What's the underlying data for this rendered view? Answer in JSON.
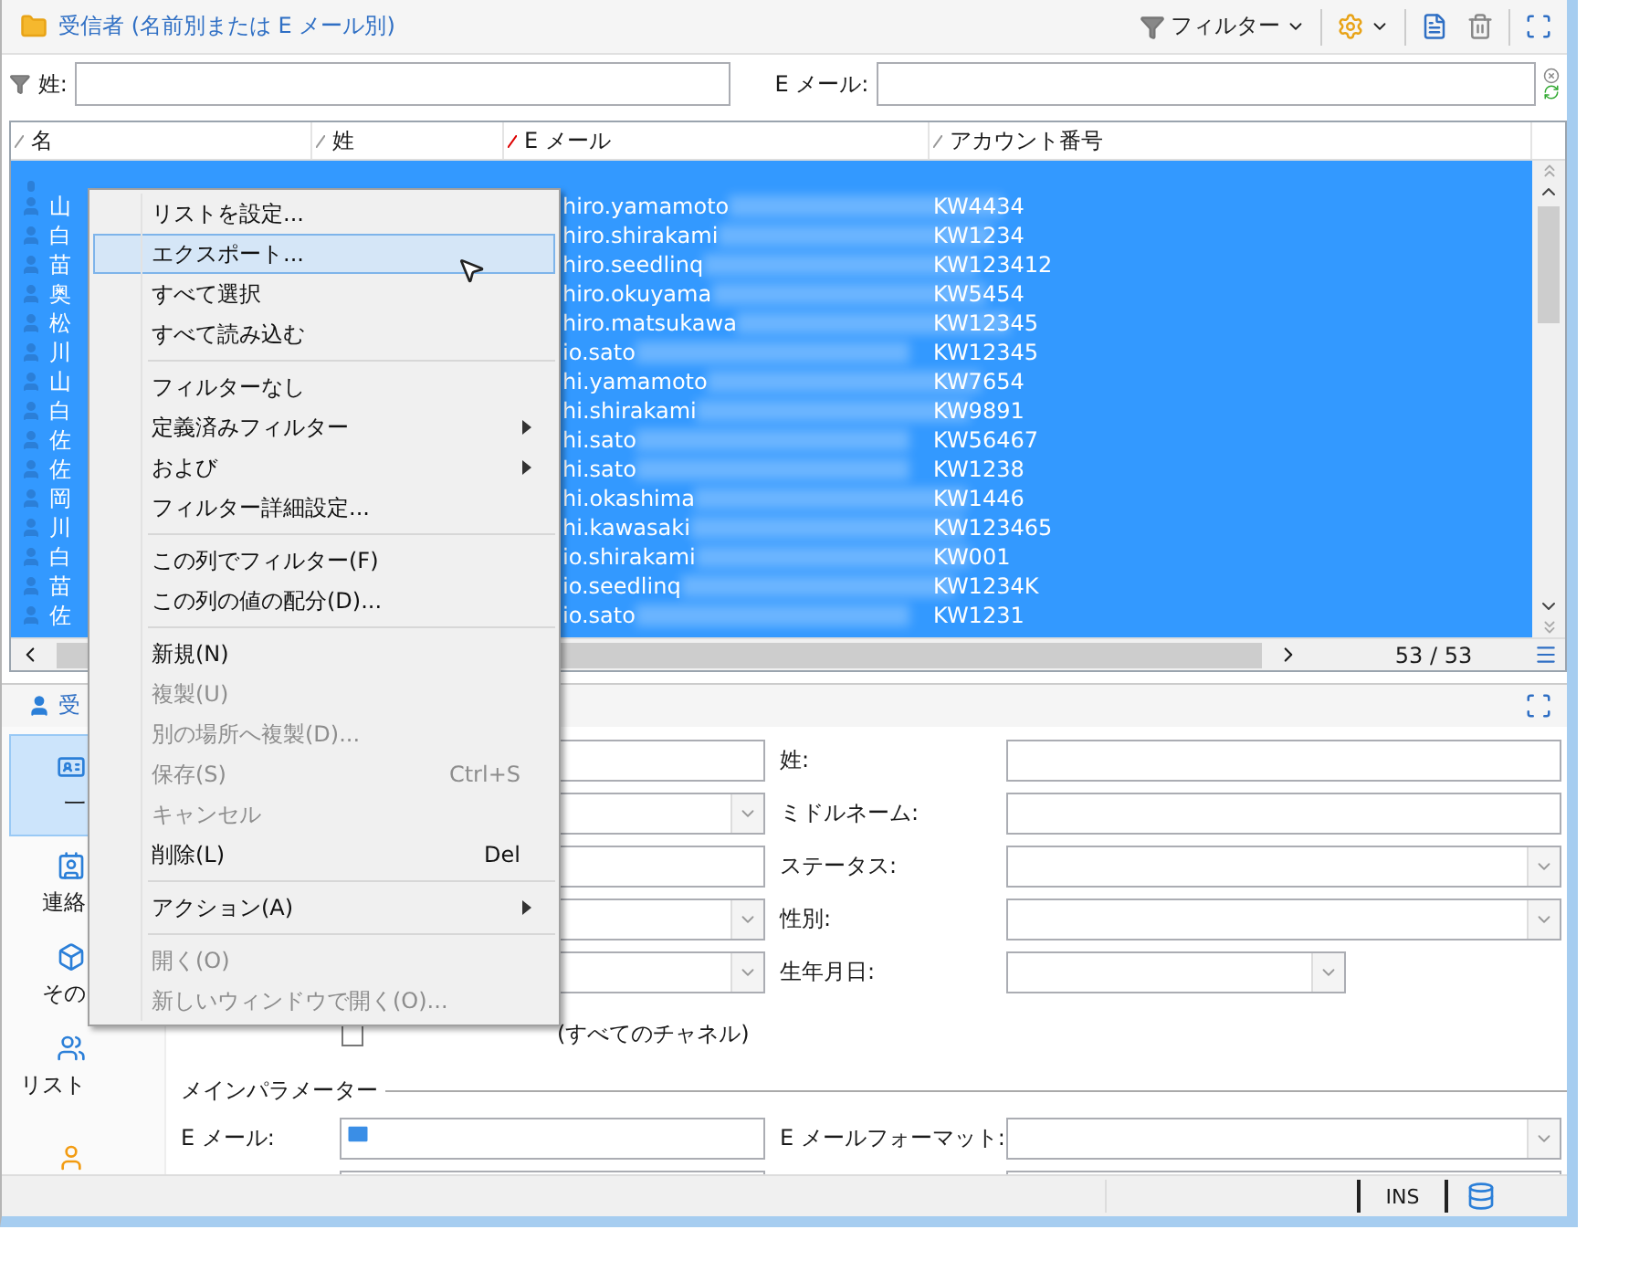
{
  "header": {
    "title": "受信者 (名前別または E メール別)",
    "filter_button": "フィルター"
  },
  "filter_bar": {
    "last_name_label": "姓:",
    "email_label": "E メール:"
  },
  "table": {
    "columns": [
      "名",
      "姓",
      "E メール",
      "アカウント番号"
    ],
    "rows": [
      {
        "first_name": "山",
        "email": "hiro.yamamoto",
        "account": "KW4434",
        "selected": true
      },
      {
        "first_name": "白",
        "email": "hiro.shirakami",
        "account": "KW1234",
        "selected": true
      },
      {
        "first_name": "苗",
        "email": "hiro.seedlinq",
        "account": "KW123412",
        "selected": true
      },
      {
        "first_name": "奥",
        "email": "hiro.okuyama",
        "account": "KW5454",
        "selected": true
      },
      {
        "first_name": "松",
        "email": "hiro.matsukawa",
        "account": "KW12345",
        "selected": true
      },
      {
        "first_name": "川",
        "email": "io.sato",
        "account": "KW12345",
        "selected": true
      },
      {
        "first_name": "山",
        "email": "hi.yamamoto",
        "account": "KW7654",
        "selected": true
      },
      {
        "first_name": "白",
        "email": "hi.shirakami",
        "account": "KW9891",
        "selected": true
      },
      {
        "first_name": "佐",
        "email": "hi.sato",
        "account": "KW56467",
        "selected": true
      },
      {
        "first_name": "佐",
        "email": "hi.sato",
        "account": "KW1238",
        "selected": true
      },
      {
        "first_name": "岡",
        "email": "hi.okashima",
        "account": "KW1446",
        "selected": true
      },
      {
        "first_name": "川",
        "email": "hi.kawasaki",
        "account": "KW123465",
        "selected": true
      },
      {
        "first_name": "白",
        "email": "io.shirakami",
        "account": "KW001",
        "selected": true
      },
      {
        "first_name": "苗",
        "email": "io.seedlinq",
        "account": "KW1234K",
        "selected": true
      },
      {
        "first_name": "佐",
        "email": "io.sato",
        "account": "KW1231",
        "selected": true
      }
    ],
    "count": "53 / 53"
  },
  "context_menu": {
    "items": [
      {
        "kind": "item",
        "label": "リストを設定...",
        "selected": false,
        "disabled": false
      },
      {
        "kind": "item",
        "label": "エクスポート...",
        "selected": true,
        "disabled": false
      },
      {
        "kind": "item",
        "label": "すべて選択",
        "selected": false,
        "disabled": false
      },
      {
        "kind": "item",
        "label": "すべて読み込む",
        "selected": false,
        "disabled": false
      },
      {
        "kind": "separator"
      },
      {
        "kind": "item",
        "label": "フィルターなし",
        "selected": false,
        "disabled": false
      },
      {
        "kind": "submenu",
        "label": "定義済みフィルター",
        "selected": false,
        "disabled": false
      },
      {
        "kind": "submenu",
        "label": "および",
        "selected": false,
        "disabled": false
      },
      {
        "kind": "item",
        "label": "フィルター詳細設定...",
        "selected": false,
        "disabled": false
      },
      {
        "kind": "separator"
      },
      {
        "kind": "item",
        "label": "この列でフィルター(F)",
        "selected": false,
        "disabled": false
      },
      {
        "kind": "item",
        "label": "この列の値の配分(D)...",
        "selected": false,
        "disabled": false
      },
      {
        "kind": "separator"
      },
      {
        "kind": "item",
        "label": "新規(N)",
        "selected": false,
        "disabled": false
      },
      {
        "kind": "item",
        "label": "複製(U)",
        "selected": false,
        "disabled": true
      },
      {
        "kind": "item",
        "label": "別の場所へ複製(D)...",
        "selected": false,
        "disabled": true
      },
      {
        "kind": "item",
        "label": "保存(S)",
        "shortcut": "Ctrl+S",
        "selected": false,
        "disabled": true
      },
      {
        "kind": "item",
        "label": "キャンセル",
        "selected": false,
        "disabled": true
      },
      {
        "kind": "item",
        "label": "削除(L)",
        "shortcut": "Del",
        "selected": false,
        "disabled": false
      },
      {
        "kind": "separator"
      },
      {
        "kind": "submenu",
        "label": "アクション(A)",
        "selected": false,
        "disabled": false
      },
      {
        "kind": "separator"
      },
      {
        "kind": "item",
        "label": "開く(O)",
        "selected": false,
        "disabled": true
      },
      {
        "kind": "item",
        "label": "新しいウィンドウで開く(O)...",
        "selected": false,
        "disabled": true
      }
    ]
  },
  "detail": {
    "title": "受",
    "nav": [
      {
        "label": "一",
        "selected": true
      },
      {
        "label": "連絡",
        "selected": false
      },
      {
        "label": "その",
        "selected": false
      },
      {
        "label": "リスト",
        "selected": false
      },
      {
        "selected": false
      }
    ],
    "left_fields": [
      {
        "kind": "text"
      },
      {
        "kind": "dropdown"
      },
      {
        "kind": "text"
      },
      {
        "kind": "dropdown"
      },
      {
        "kind": "dropdown"
      }
    ],
    "right_fields": [
      {
        "label": "姓:",
        "kind": "text"
      },
      {
        "label": "ミドルネーム:",
        "kind": "text"
      },
      {
        "label": "ステータス:",
        "kind": "dropdown"
      },
      {
        "label": "性別:",
        "kind": "dropdown"
      },
      {
        "label": "生年月日:",
        "kind": "date"
      }
    ],
    "checkbox": {
      "label": "(すべてのチャネル)",
      "checked": false
    },
    "section_title": "メインパラメーター",
    "email_label": "E メール:",
    "email_format_label": "E メールフォーマット:"
  },
  "status_bar": {
    "mode": "INS"
  }
}
